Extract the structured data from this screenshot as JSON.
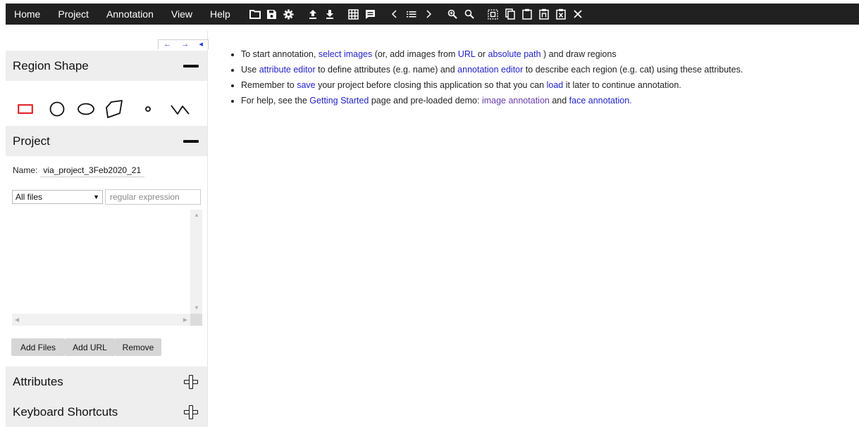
{
  "menu": {
    "items": [
      "Home",
      "Project",
      "Annotation",
      "View",
      "Help"
    ]
  },
  "toolbar": {
    "icons": [
      "folder-icon",
      "save-icon",
      "settings-icon",
      "upload-icon",
      "download-icon",
      "grid-view-icon",
      "annotation-editor-icon",
      "previous-icon",
      "list-icon",
      "next-icon",
      "zoom-in-icon",
      "zoom-out-icon",
      "select-all-icon",
      "copy-icon",
      "paste-icon",
      "paste-n-icon",
      "delete-region-icon",
      "close-icon"
    ]
  },
  "sidebar": {
    "nav_arrows": [
      "←",
      "→",
      "◂"
    ],
    "region_shape": {
      "title": "Region Shape",
      "shapes": [
        "rectangle",
        "circle",
        "ellipse",
        "polygon",
        "point",
        "polyline"
      ],
      "active_shape": "rectangle"
    },
    "project": {
      "title": "Project",
      "name_label": "Name:",
      "name_value": "via_project_3Feb2020_21",
      "filter_selected": "All files",
      "regex_placeholder": "regular expression",
      "buttons": {
        "add_files": "Add Files",
        "add_url": "Add URL",
        "remove": "Remove"
      }
    },
    "attributes": {
      "title": "Attributes"
    },
    "keyboard_shortcuts": {
      "title": "Keyboard Shortcuts"
    }
  },
  "instructions": {
    "line1": {
      "t1": "To start annotation,",
      "link1": "select images",
      "t2": "(or, add images from",
      "link2": "URL",
      "t3": "or",
      "link3": "absolute path",
      "t4": ") and draw regions"
    },
    "line2": {
      "t1": "Use",
      "link1": "attribute editor",
      "t2": "to define attributes (e.g. name) and",
      "link2": "annotation editor",
      "t3": "to describe each region (e.g. cat) using these attributes."
    },
    "line3": {
      "t1": "Remember to",
      "link1": "save",
      "t2": "your project before closing this application so that you can",
      "link2": "load",
      "t3": "it later to continue annotation."
    },
    "line4": {
      "t1": "For help, see the",
      "link1": "Getting Started",
      "t2": "page and pre-loaded demo:",
      "link2": "image annotation",
      "t3": "and",
      "link3": "face annotation."
    }
  },
  "colors": {
    "topbar_bg": "#212121",
    "panel_header_bg": "#eeeeee",
    "link": "#2323c8",
    "link_visited": "#6a3aa8",
    "active_shape": "#e0151b"
  }
}
